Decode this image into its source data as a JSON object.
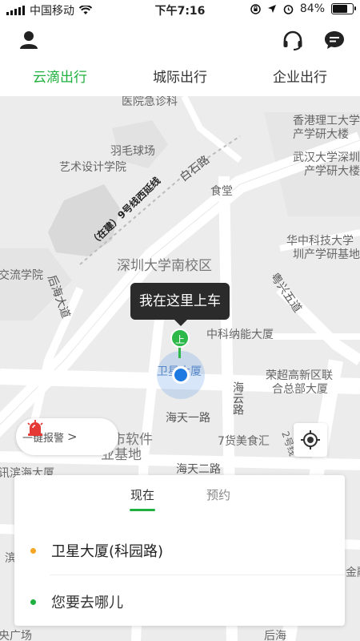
{
  "status_bar": {
    "carrier": "中国移动",
    "time": "下午7:16",
    "battery": "84%",
    "battery_level": 0.84
  },
  "header": {
    "icons": [
      "user-icon",
      "headset-icon",
      "message-icon"
    ],
    "tabs": [
      {
        "label": "云滴出行",
        "active": true
      },
      {
        "label": "城际出行",
        "active": false
      },
      {
        "label": "企业出行",
        "active": false
      }
    ]
  },
  "map": {
    "labels": {
      "hospital": "医院急诊科",
      "hku_lab_1": "香港理工大学",
      "hku_lab_2": "产学研大楼",
      "badminton": "羽毛球场",
      "art_design": "艺术设计学院",
      "baishi_road": "白石路",
      "canteen": "食堂",
      "wuhan_uni_1": "武汉大学深圳",
      "wuhan_uni_2": "产学研大楼",
      "metro_line": "（在建）9号线西延线",
      "hust_1": "华中科技大学",
      "hust_2": "圳产学研基地",
      "exchange_college": "交流学院",
      "szu_south": "深圳大学南校区",
      "houhai_ave": "后海大道",
      "yuexing_5th": "粤兴五道",
      "zhongke_building": "中科纳能大厦",
      "weixing_fragment": "卫星大厦",
      "rongchao_1": "荣超高新区联",
      "rongchao_2": "合总部大厦",
      "haiyun_road": "海云路",
      "haitian_1st": "海天一路",
      "software_1": "市软件",
      "software_2": "业基地",
      "qihuo": "7货美食汇",
      "line2": "2号线",
      "xunbin": "讯滨海大厦",
      "haitian_2nd": "海天二路",
      "bin": "滨",
      "jin": "金融",
      "guangchang": "央广场",
      "houhai": "后海"
    },
    "pickup_bubble": "我在这里上车",
    "pickup_pin": "上",
    "alarm_label": "一键报警",
    "alarm_arrow": ">"
  },
  "booking_card": {
    "tabs": [
      {
        "label": "现在",
        "active": true
      },
      {
        "label": "预约",
        "active": false
      }
    ],
    "origin": "卫星大厦(科园路)",
    "destination": "您要去哪儿",
    "origin_dot_color": "#f5a623",
    "destination_dot_color": "#1fb13f"
  },
  "colors": {
    "accent_green": "#1fb13f",
    "location_blue": "#1e7ae0"
  }
}
